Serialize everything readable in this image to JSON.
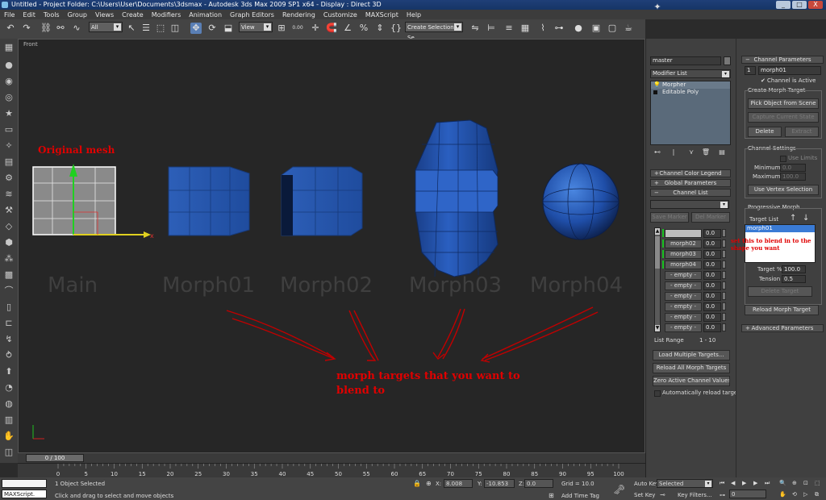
{
  "titlebar": {
    "title": "Untitled      - Project Folder: C:\\Users\\User\\Documents\\3dsmax      - Autodesk 3ds Max  2009 SP1  x64      - Display : Direct 3D",
    "min": "_",
    "max": "□",
    "close": "X"
  },
  "menubar": [
    "File",
    "Edit",
    "Tools",
    "Group",
    "Views",
    "Create",
    "Modifiers",
    "Animation",
    "Graph Editors",
    "Rendering",
    "Customize",
    "MAXScript",
    "Help"
  ],
  "toolbar": {
    "selection_filter": "All",
    "ref_coord": "View",
    "named_selection": "Create Selection Se",
    "snap_value": "0.00"
  },
  "viewport": {
    "label": "Front",
    "object_labels": [
      "Main",
      "Morph01",
      "Morph02",
      "Morph03",
      "Morph04"
    ],
    "annotation_original": "Original mesh",
    "annotation_targets_line1": "morph targets that you want to",
    "annotation_targets_line2": "blend to",
    "annotation_side": "set this to blend in to the shape you want"
  },
  "timeslider": {
    "position": "0 / 100"
  },
  "ruler": {
    "ticks": [
      "0",
      "5",
      "10",
      "15",
      "20",
      "25",
      "30",
      "35",
      "40",
      "45",
      "50",
      "55",
      "60",
      "65",
      "70",
      "75",
      "80",
      "85",
      "90",
      "95",
      "100"
    ]
  },
  "status": {
    "maxscript": "MAXScript.",
    "selected": "1 Object Selected",
    "prompt": "Click and drag to select and move objects",
    "x_label": "X:",
    "x": "8.008",
    "y_label": "Y:",
    "y": "-10.853",
    "z_label": "Z:",
    "z": "0.0",
    "grid": "Grid = 10.0",
    "add_time_tag": "Add Time Tag",
    "auto_key": "Auto Key",
    "set_key": "Set Key",
    "key_mode": "Selected",
    "key_filters": "Key Filters...",
    "frame": "0"
  },
  "modifier_panel": {
    "object_name": "master",
    "modifier_list": "Modifier List",
    "stack": [
      "Morpher",
      "Editable Poly"
    ],
    "rollouts": [
      "Channel Color Legend",
      "Global Parameters",
      "Channel List"
    ],
    "save_marker": "Save Marker",
    "del_marker": "Del Marker",
    "channels": [
      {
        "name": "",
        "value": "0.0",
        "active": true
      },
      {
        "name": "morph02",
        "value": "0.0",
        "active": true
      },
      {
        "name": "morph03",
        "value": "0.0",
        "active": true
      },
      {
        "name": "morph04",
        "value": "0.0",
        "active": true
      },
      {
        "name": "- empty -",
        "value": "0.0",
        "active": false
      },
      {
        "name": "- empty -",
        "value": "0.0",
        "active": false
      },
      {
        "name": "- empty -",
        "value": "0.0",
        "active": false
      },
      {
        "name": "- empty -",
        "value": "0.0",
        "active": false
      },
      {
        "name": "- empty -",
        "value": "0.0",
        "active": false
      },
      {
        "name": "- empty -",
        "value": "0.0",
        "active": false
      }
    ],
    "list_range_label": "List Range",
    "list_range": "1 - 10",
    "load_multiple": "Load Multiple Targets...",
    "reload_all": "Reload All Morph Targets",
    "zero_active": "Zero Active Channel Values",
    "auto_reload": "Automatically reload targets"
  },
  "channel_panel": {
    "header": "Channel Parameters",
    "channel_number": "1",
    "channel_name": "morph01",
    "channel_active": "Channel is Active",
    "create_morph_target": "Create Morph Target",
    "pick_object": "Pick Object from Scene",
    "capture_state": "Capture Current State",
    "delete": "Delete",
    "extract": "Extract",
    "channel_settings": "Channel Settings",
    "use_limits": "Use Limits",
    "minimum_label": "Minimum",
    "minimum": "0.0",
    "maximum_label": "Maximum",
    "maximum": "100.0",
    "use_vertex_selection": "Use Vertex Selection",
    "progressive_morph": "Progressive Morph",
    "target_list": "Target List",
    "targets": [
      "morph01"
    ],
    "target_pct_label": "Target %:",
    "target_pct": "100.0",
    "tension_label": "Tension :",
    "tension": "0.5",
    "delete_target": "Delete Target",
    "reload_morph_target": "Reload Morph Target",
    "advanced_parameters": "Advanced Parameters"
  }
}
